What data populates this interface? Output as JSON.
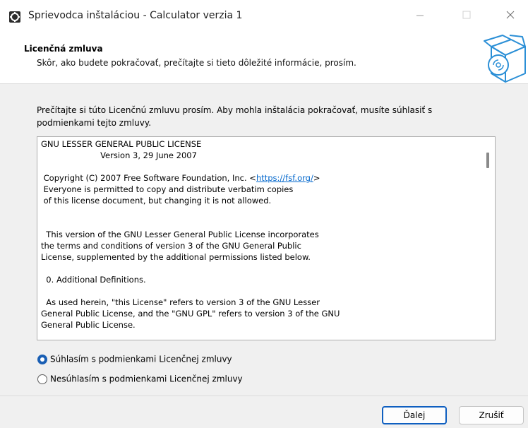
{
  "window": {
    "title": "Sprievodca inštaláciou - Calculator verzia 1"
  },
  "header": {
    "title": "Licenčná zmluva",
    "subtitle": "Skôr, ako budete pokračovať, prečítajte si tieto dôležité informácie, prosím."
  },
  "main": {
    "intro": "Prečítajte si túto Licenčnú zmluvu prosím. Aby mohla inštalácia pokračovať, musíte súhlasiť s podmienkami tejto zmluvy.",
    "license": {
      "heading": "GNU LESSER GENERAL PUBLIC LICENSE",
      "version": "                       Version 3, 29 June 2007",
      "copyright_before": " Copyright (C) 2007 Free Software Foundation, Inc. <",
      "link": "https://fsf.org/",
      "copyright_after": ">",
      "body1": " Everyone is permitted to copy and distribute verbatim copies\n of this license document, but changing it is not allowed.",
      "body2": "  This version of the GNU Lesser General Public License incorporates\nthe terms and conditions of version 3 of the GNU General Public\nLicense, supplemented by the additional permissions listed below.",
      "body3": "  0. Additional Definitions.",
      "body4": "  As used herein, \"this License\" refers to version 3 of the GNU Lesser\nGeneral Public License, and the \"GNU GPL\" refers to version 3 of the GNU\nGeneral Public License."
    },
    "radio_accept": "Súhlasím s podmienkami Licenčnej zmluvy",
    "radio_decline": "Nesúhlasím s podmienkami Licenčnej zmluvy",
    "accept_selected": true
  },
  "buttons": {
    "next": "Ďalej",
    "cancel": "Zrušiť"
  },
  "colors": {
    "accent": "#1a5fb4",
    "link": "#0066cc"
  }
}
